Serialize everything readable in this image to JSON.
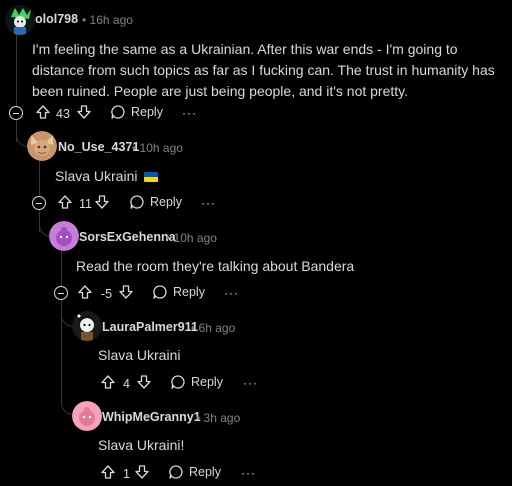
{
  "comments": [
    {
      "username": "olol798",
      "time": "16h ago",
      "text": "I'm feeling the same as a Ukrainian. After this war ends - I'm going to distance from such topics as far as I fucking can. The trust in humanity has been ruined. People are just being people, and it's not pretty.",
      "score": "43",
      "reply_label": "Reply",
      "more": "···"
    },
    {
      "username": "No_Use_4371",
      "time": "10h ago",
      "text": "Slava Ukraini",
      "flag": "ukraine-flag",
      "score": "11",
      "reply_label": "Reply",
      "more": "···"
    },
    {
      "username": "SorsExGehenna",
      "time": "10h ago",
      "text": "Read the room they're talking about Bandera",
      "score": "-5",
      "reply_label": "Reply",
      "more": "···"
    },
    {
      "username": "LauraPalmer911",
      "time": "6h ago",
      "text": "Slava Ukraini",
      "score": "4",
      "reply_label": "Reply",
      "more": "···"
    },
    {
      "username": "WhipMeGranny1",
      "time": "3h ago",
      "text": "Slava Ukraini!",
      "score": "1",
      "reply_label": "Reply",
      "more": "···"
    }
  ],
  "meta_sep": "•",
  "colors": {
    "background": "#000000",
    "text": "#d7dadc",
    "muted": "#818384",
    "thread": "#343536",
    "flag_blue": "#0057b7",
    "flag_yellow": "#ffd700"
  }
}
